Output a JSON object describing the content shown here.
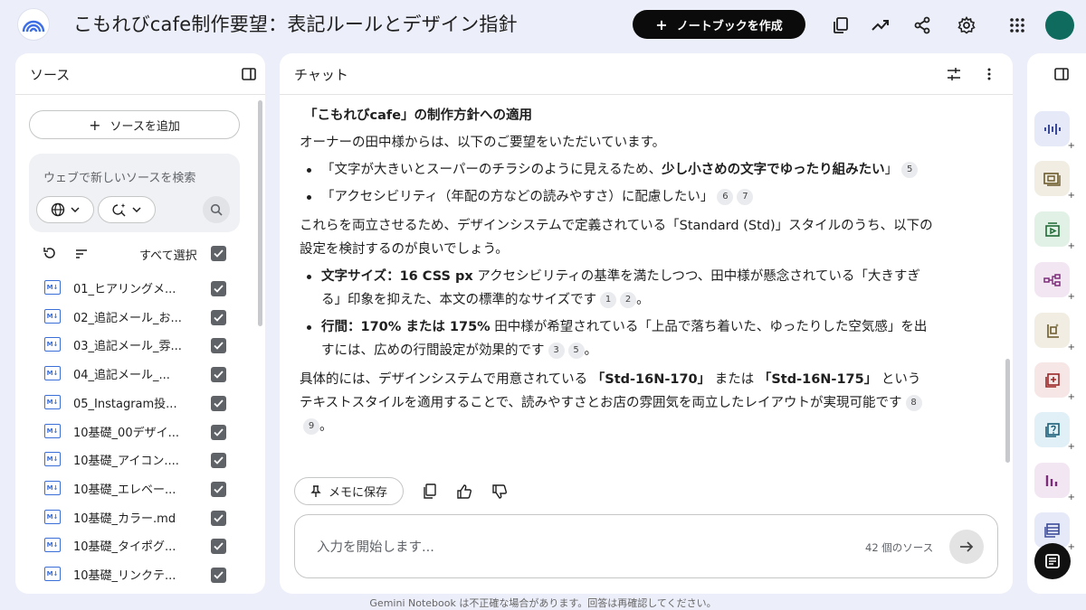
{
  "header": {
    "title": "こもれびcafe制作要望：表記ルールとデザイン指針",
    "create_notebook_label": "ノートブックを作成"
  },
  "sources_panel": {
    "title": "ソース",
    "add_source_label": "ソースを追加",
    "search_placeholder": "ウェブで新しいソースを検索",
    "select_all_label": "すべて選択",
    "items": [
      {
        "label": "01_ヒアリングメ..."
      },
      {
        "label": "02_追記メール_お..."
      },
      {
        "label": "03_追記メール_雰..."
      },
      {
        "label": "04_追記メール_..."
      },
      {
        "label": "05_Instagram投..."
      },
      {
        "label": "10基礎_00デザイ..."
      },
      {
        "label": "10基礎_アイコン...."
      },
      {
        "label": "10基礎_エレベー..."
      },
      {
        "label": "10基礎_カラー.md"
      },
      {
        "label": "10基礎_タイポグ..."
      },
      {
        "label": "10基礎_リンクテ..."
      }
    ]
  },
  "chat_panel": {
    "title": "チャット",
    "heading": "「こもれびcafe」の制作方針への適用",
    "intro": "オーナーの田中様からは、以下のご要望をいただいています。",
    "bullet1_pre": "「文字が大きいとスーパーのチラシのように見えるため、",
    "bullet1_bold": "少し小さめの文字でゆったり組みたい",
    "bullet1_post": "」",
    "bullet1_cites": [
      "5"
    ],
    "bullet2": "「アクセシビリティ（年配の方などの読みやすさ）に配慮したい」",
    "bullet2_cites": [
      "6",
      "7"
    ],
    "para2": "これらを両立させるため、デザインシステムで定義されている「Standard (Std)」スタイルのうち、以下の設定を検討するのが良いでしょう。",
    "setting1_bold": "文字サイズ：16 CSS px",
    "setting1_text": " アクセシビリティの基準を満たしつつ、田中様が懸念されている「大きすぎる」印象を抑えた、本文の標準的なサイズです",
    "setting1_cites": [
      "1",
      "2"
    ],
    "setting1_end": "。",
    "setting2_bold": "行間：170% または 175%",
    "setting2_text": " 田中様が希望されている「上品で落ち着いた、ゆったりした空気感」を出すには、広めの行間設定が効果的です",
    "setting2_cites": [
      "3",
      "5"
    ],
    "setting2_end": "。",
    "para3_a": "具体的には、デザインシステムで用意されている ",
    "para3_b1": "「Std-16N-170」",
    "para3_mid": " または ",
    "para3_b2": "「Std-16N-175」",
    "para3_c": " というテキストスタイルを適用することで、読みやすさとお店の雰囲気を両立したレイアウトが実現可能です",
    "para3_cites": [
      "8",
      "9"
    ],
    "para3_end": "。",
    "save_memo_label": "メモに保存",
    "input_placeholder": "入力を開始します...",
    "source_count": "42 個のソース"
  },
  "footer": {
    "disclaimer": "Gemini Notebook は不正確な場合があります。回答は再確認してください。"
  },
  "colors": {
    "background": "#eceef9",
    "panel": "#ffffff",
    "create_button": "#0b0b0b",
    "avatar": "#0e6b5e",
    "md_icon": "#3a6fd8"
  }
}
